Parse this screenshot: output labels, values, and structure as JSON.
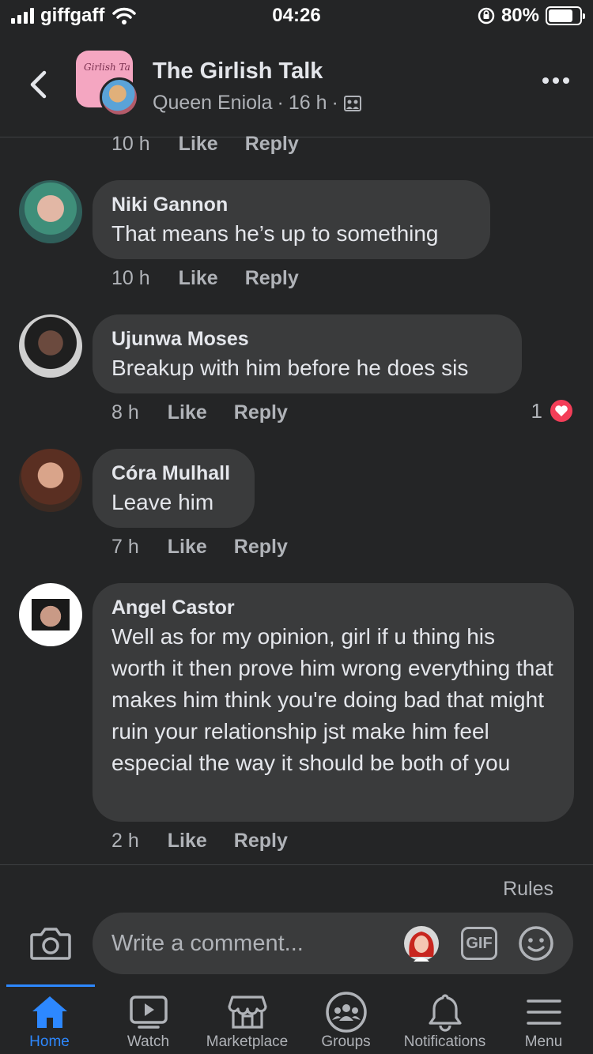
{
  "status_bar": {
    "carrier": "giffgaff",
    "time": "04:26",
    "battery": "80%",
    "battery_level": 0.8
  },
  "header": {
    "group_name": "The Girlish Talk",
    "author": "Queen Eniola",
    "time": "16 h",
    "back_icon": "chevron-left-icon",
    "more_icon": "more-dots-icon"
  },
  "comments": [
    {
      "name": "",
      "text": "",
      "time": "10 h",
      "like": "Like",
      "reply": "Reply"
    },
    {
      "name": "Niki Gannon",
      "text": "That means he’s up to something",
      "time": "10 h",
      "like": "Like",
      "reply": "Reply"
    },
    {
      "name": "Ujunwa Moses",
      "text": "Breakup with him before he does sis",
      "time": "8 h",
      "like": "Like",
      "reply": "Reply",
      "reaction_count": "1"
    },
    {
      "name": "Córa Mulhall",
      "text": "Leave him",
      "time": "7 h",
      "like": "Like",
      "reply": "Reply"
    },
    {
      "name": "Angel Castor",
      "text": "Well as for my opinion, girl if u thing his worth it then prove him wrong everything that makes him think you're doing bad that might ruin your relationship jst make him feel especial the way it should be both of you",
      "time": "2 h",
      "like": "Like",
      "reply": "Reply"
    }
  ],
  "composer": {
    "rules": "Rules",
    "placeholder": "Write a comment...",
    "gif": "GIF"
  },
  "tabs": [
    {
      "label": "Home",
      "icon": "home-icon",
      "active": true
    },
    {
      "label": "Watch",
      "icon": "watch-icon"
    },
    {
      "label": "Marketplace",
      "icon": "marketplace-icon"
    },
    {
      "label": "Groups",
      "icon": "groups-icon"
    },
    {
      "label": "Notifications",
      "icon": "bell-icon"
    },
    {
      "label": "Menu",
      "icon": "menu-icon"
    }
  ],
  "colors": {
    "background": "#242526",
    "bubble": "#3a3b3c",
    "accent": "#2d88ff",
    "heart": "#f33e58"
  }
}
